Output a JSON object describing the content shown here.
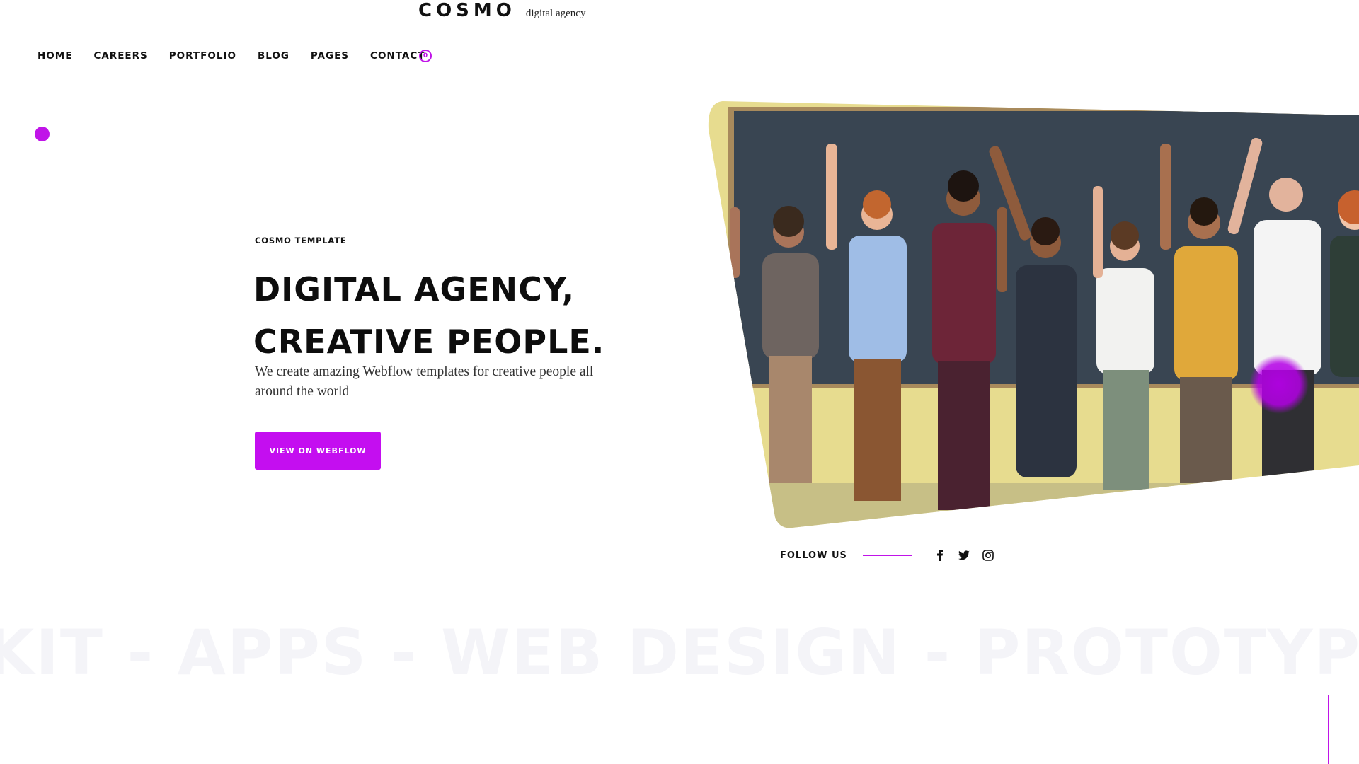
{
  "brand": {
    "logo": "COSMO",
    "tagline": "digital agency",
    "accent_color": "#c014e8"
  },
  "nav": {
    "items": [
      {
        "label": "HOME"
      },
      {
        "label": "CAREERS"
      },
      {
        "label": "PORTFOLIO"
      },
      {
        "label": "BLOG"
      },
      {
        "label": "PAGES"
      },
      {
        "label": "CONTACT"
      }
    ],
    "cart_count": "0"
  },
  "hero": {
    "eyebrow": "COSMO TEMPLATE",
    "headline_line1": "DIGITAL AGENCY,",
    "headline_line2": "CREATIVE PEOPLE.",
    "subtext": "We create amazing Webflow templates for creative people all around the world",
    "cta_label": "VIEW ON WEBFLOW",
    "image": "group of smiling people raising fists in front of chalkboard"
  },
  "social": {
    "label": "FOLLOW US",
    "icons": [
      "facebook-icon",
      "twitter-icon",
      "instagram-icon"
    ]
  },
  "marquee": {
    "text": "KIT - APPS - WEB DESIGN - PROTOTYPING"
  }
}
